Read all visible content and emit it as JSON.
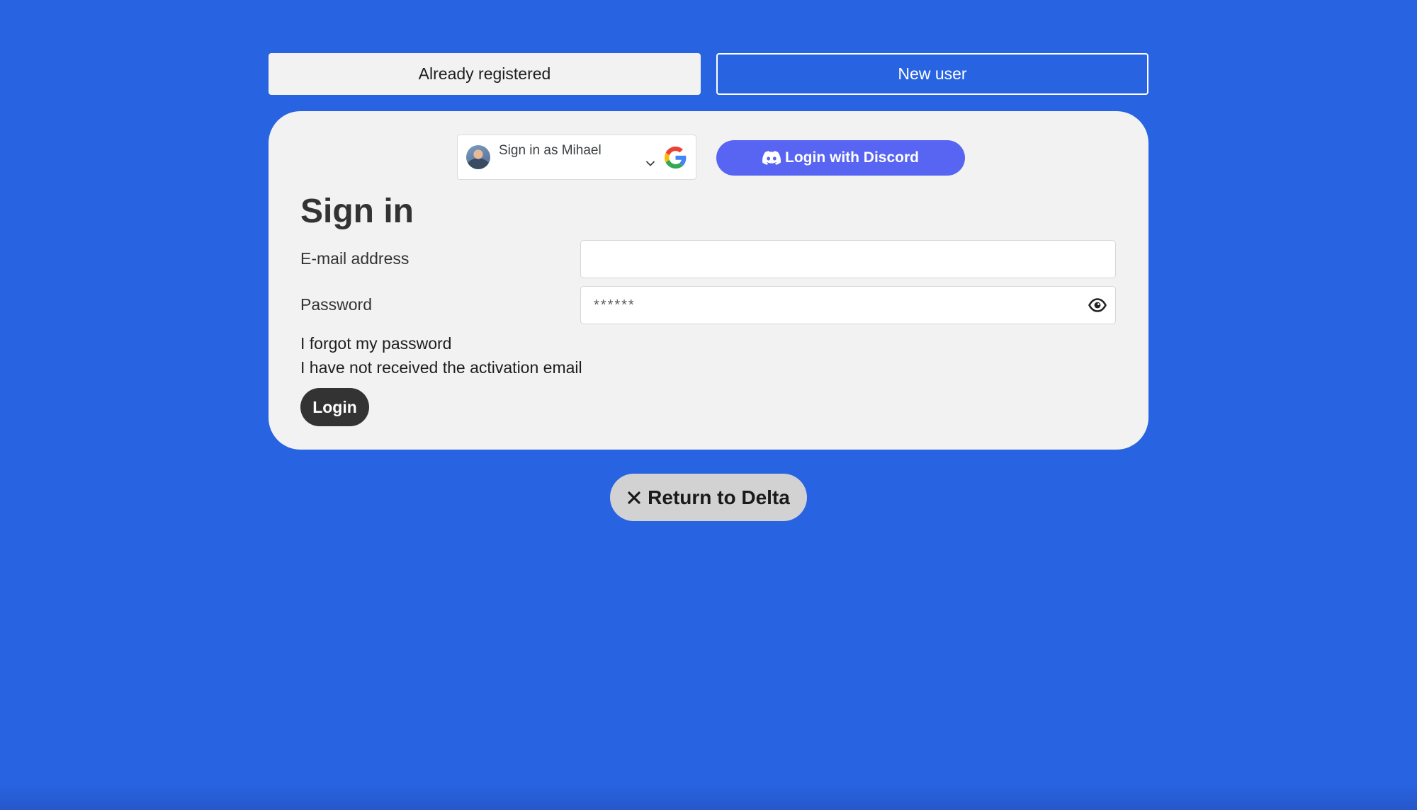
{
  "tabs": {
    "active_label": "Already registered",
    "inactive_label": "New user"
  },
  "google": {
    "label": "Sign in as Mihael"
  },
  "discord": {
    "label": "Login with Discord"
  },
  "form": {
    "heading": "Sign in",
    "email_label": "E-mail address",
    "email_value": "",
    "password_label": "Password",
    "password_placeholder": "******",
    "forgot_link": "I forgot my password",
    "activation_link": "I have not received the activation email",
    "login_label": "Login"
  },
  "return": {
    "label": "Return to Delta"
  },
  "colors": {
    "background": "#2864e2",
    "card": "#f2f2f2",
    "discord": "#5865f2",
    "login_button": "#333333",
    "return_button": "#d2d2d2"
  },
  "icons": [
    "avatar",
    "chevron-down-icon",
    "google-logo-icon",
    "discord-icon",
    "eye-icon",
    "close-icon"
  ]
}
